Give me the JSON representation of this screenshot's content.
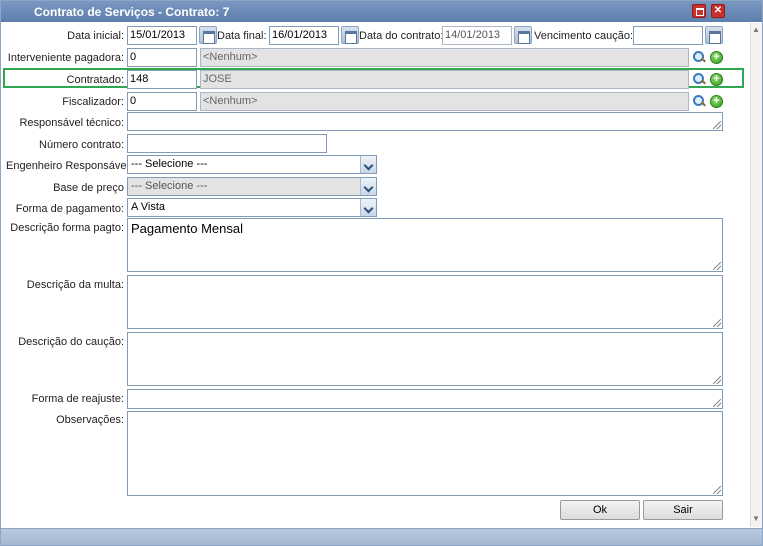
{
  "window": {
    "title": "Contrato de Serviços - Contrato: 7"
  },
  "row1": {
    "data_inicial_label": "Data inicial:",
    "data_inicial_value": "15/01/2013",
    "data_final_label": "Data final:",
    "data_final_value": "16/01/2013",
    "data_contrato_label": "Data do contrato:",
    "data_contrato_value": "14/01/2013",
    "vencimento_label": "Vencimento caução:",
    "vencimento_value": ""
  },
  "interveniente": {
    "label": "Interveniente pagadora:",
    "code": "0",
    "name": "<Nenhum>"
  },
  "contratado": {
    "label": "Contratado:",
    "code": "148",
    "name": "JOSE"
  },
  "fiscalizador": {
    "label": "Fiscalizador:",
    "code": "0",
    "name": "<Nenhum>"
  },
  "responsavel_tecnico": {
    "label": "Responsável técnico:",
    "value": ""
  },
  "numero_contrato": {
    "label": "Número contrato:",
    "value": ""
  },
  "engenheiro": {
    "label": "Engenheiro Responsável:",
    "selected": "--- Selecione ---"
  },
  "base_preco": {
    "label": "Base de preço",
    "selected": "--- Selecione ---"
  },
  "forma_pagamento": {
    "label": "Forma de pagamento:",
    "selected": "A Vista"
  },
  "descricao_forma_pagto": {
    "label": "Descrição forma pagto:",
    "value": "Pagamento Mensal"
  },
  "descricao_multa": {
    "label": "Descrição da multa:",
    "value": ""
  },
  "descricao_caucao": {
    "label": "Descrição do caução:",
    "value": ""
  },
  "forma_reajuste": {
    "label": "Forma de reajuste:",
    "value": ""
  },
  "observacoes": {
    "label": "Observações:",
    "value": ""
  },
  "buttons": {
    "ok": "Ok",
    "sair": "Sair"
  },
  "colors": {
    "titlebar": "#6b8ab6",
    "highlight": "#2fa84f",
    "close": "#c9302c"
  },
  "icons": [
    "calendar-icon",
    "search-icon",
    "add-icon",
    "maximize-icon",
    "close-icon",
    "chevron-down-icon",
    "resize-grip-icon"
  ]
}
